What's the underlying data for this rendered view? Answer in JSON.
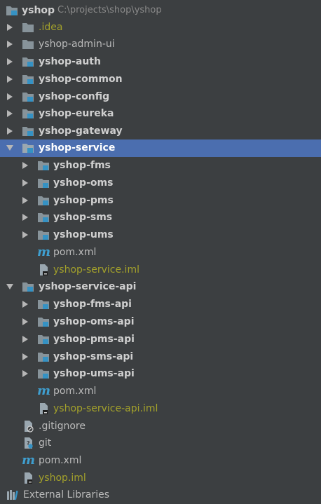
{
  "project": {
    "name": "yshop",
    "path": "C:\\projects\\shop\\yshop"
  },
  "items": [
    {
      "label": ".idea",
      "style": "olive"
    },
    {
      "label": "yshop-admin-ui",
      "style": "normal"
    },
    {
      "label": "yshop-auth",
      "style": "bold"
    },
    {
      "label": "yshop-common",
      "style": "bold"
    },
    {
      "label": "yshop-config",
      "style": "bold"
    },
    {
      "label": "yshop-eureka",
      "style": "bold"
    },
    {
      "label": "yshop-gateway",
      "style": "bold"
    },
    {
      "label": "yshop-service",
      "style": "bold",
      "selected": true
    },
    {
      "label": "yshop-fms",
      "style": "bold"
    },
    {
      "label": "yshop-oms",
      "style": "bold"
    },
    {
      "label": "yshop-pms",
      "style": "bold"
    },
    {
      "label": "yshop-sms",
      "style": "bold"
    },
    {
      "label": "yshop-ums",
      "style": "bold"
    },
    {
      "label": "pom.xml",
      "style": "normal"
    },
    {
      "label": "yshop-service.iml",
      "style": "olive"
    },
    {
      "label": "yshop-service-api",
      "style": "bold"
    },
    {
      "label": "yshop-fms-api",
      "style": "bold"
    },
    {
      "label": "yshop-oms-api",
      "style": "bold"
    },
    {
      "label": "yshop-pms-api",
      "style": "bold"
    },
    {
      "label": "yshop-sms-api",
      "style": "bold"
    },
    {
      "label": "yshop-ums-api",
      "style": "bold"
    },
    {
      "label": "pom.xml",
      "style": "normal"
    },
    {
      "label": "yshop-service-api.iml",
      "style": "olive"
    },
    {
      "label": ".gitignore",
      "style": "normal"
    },
    {
      "label": "git",
      "style": "normal"
    },
    {
      "label": "pom.xml",
      "style": "normal"
    },
    {
      "label": "yshop.iml",
      "style": "olive"
    },
    {
      "label": "External Libraries",
      "style": "normal"
    }
  ],
  "icons": {
    "expanded": "chevron-down-icon",
    "collapsed": "chevron-right-icon",
    "module": "module-folder-icon",
    "folder": "folder-icon",
    "maven": "maven-icon",
    "iml": "iml-file-icon",
    "ignore": "gitignore-file-icon",
    "libraries": "external-libraries-icon"
  },
  "colors": {
    "background": "#3c3f41",
    "selection": "#4b6eaf",
    "text": "#bbbbbb",
    "excluded_text": "#a3a12b",
    "module_badge": "#3592c4",
    "maven_m": "#3f9fd0"
  }
}
